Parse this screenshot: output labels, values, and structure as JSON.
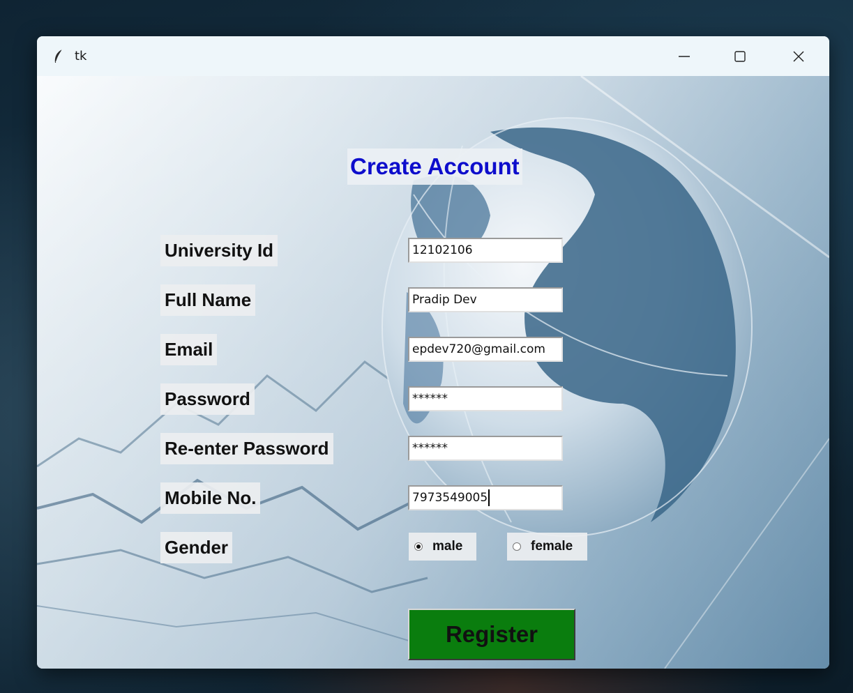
{
  "window": {
    "title": "tk",
    "app_icon": "feather-icon",
    "controls": [
      "minimize-icon",
      "maximize-icon",
      "close-icon"
    ]
  },
  "form": {
    "heading": "Create Account",
    "fields": {
      "university_id": {
        "label": "University Id",
        "value": "12102106"
      },
      "full_name": {
        "label": "Full Name",
        "value": "Pradip Dev"
      },
      "email": {
        "label": "Email",
        "value": "epdev720@gmail.com"
      },
      "password": {
        "label": "Password",
        "value": "******"
      },
      "reenter_password": {
        "label": "Re-enter Password",
        "value": "******"
      },
      "mobile": {
        "label": "Mobile No.",
        "value": "7973549005"
      }
    },
    "gender": {
      "label": "Gender",
      "options": {
        "male": "male",
        "female": "female"
      },
      "selected": "male"
    },
    "register_label": "Register"
  },
  "colors": {
    "heading": "#0d0dcc",
    "register_bg": "#0a7d0e",
    "titlebar_bg": "#eef6fa"
  }
}
